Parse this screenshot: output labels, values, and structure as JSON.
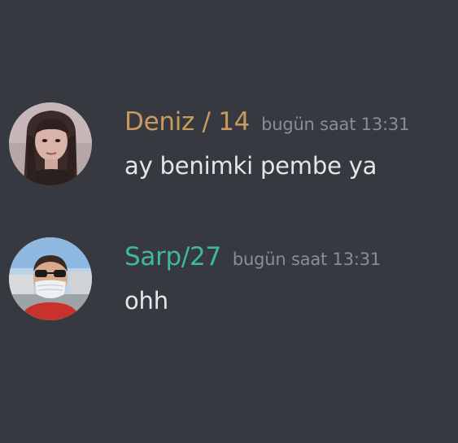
{
  "messages": [
    {
      "avatar_icon": "user-avatar-girl",
      "username": "Deniz / 14",
      "username_color": "#c89a5b",
      "timestamp": "bugün saat 13:31",
      "content": "ay benimki pembe ya"
    },
    {
      "avatar_icon": "user-avatar-masked-man",
      "username": "Sarp/27",
      "username_color": "#3fb99c",
      "timestamp": "bugün saat 13:31",
      "content": "ohh"
    }
  ],
  "colors": {
    "background": "#36393f",
    "timestamp": "#8a8d93",
    "message_text": "#e4e6e9"
  }
}
